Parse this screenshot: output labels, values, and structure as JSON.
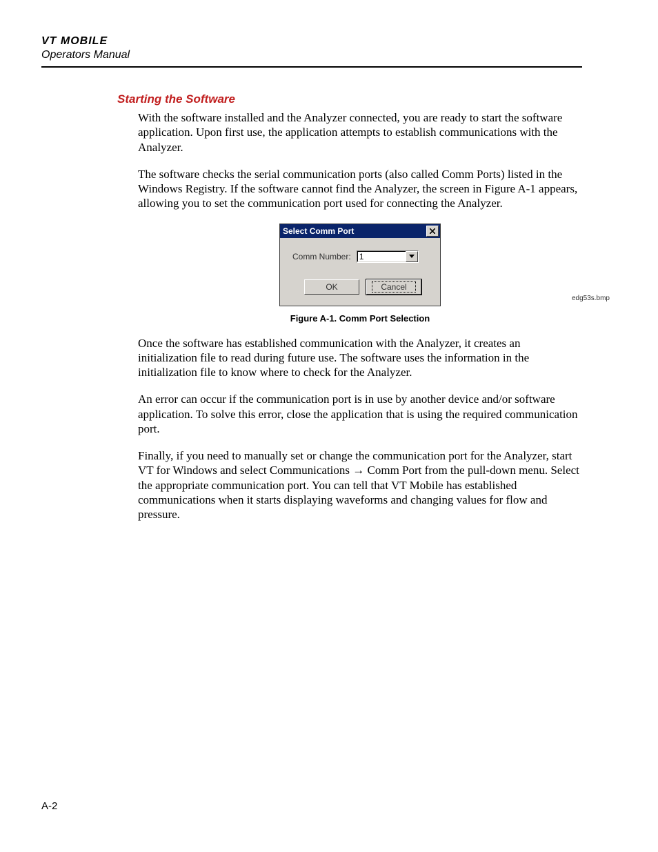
{
  "header": {
    "title": "VT MOBILE",
    "subtitle": "Operators Manual"
  },
  "section": {
    "heading": "Starting the Software",
    "p1": "With the software installed and the Analyzer connected, you are ready to start the software application. Upon first use, the application attempts to establish communications with the Analyzer.",
    "p2": "The software checks the serial communication ports (also called Comm Ports) listed in the Windows Registry. If the software cannot find the Analyzer, the screen in Figure A-1 appears, allowing you to set the communication port used for connecting the Analyzer.",
    "p3": "Once the software has established communication with the Analyzer, it creates an initialization file to read during future use. The software uses the information in the initialization file to know where to check for the Analyzer.",
    "p4": "An error can occur if the communication port is in use by another device and/or software application. To solve this error, close the application that is using the required communication port.",
    "p5a": "Finally, if you need to manually set or change the communication port for the Analyzer, start VT for Windows and select Communications ",
    "p5b": " Comm Port from the pull-down menu. Select the appropriate communication port. You can tell that VT Mobile has established communications when it starts displaying waveforms and changing values for flow and pressure."
  },
  "figure": {
    "image_filename": "edg53s.bmp",
    "caption": "Figure A-1. Comm Port Selection",
    "dialog": {
      "title": "Select Comm Port",
      "field_label": "Comm Number:",
      "field_value": "1",
      "ok_label": "OK",
      "cancel_label": "Cancel"
    }
  },
  "page_number": "A-2"
}
